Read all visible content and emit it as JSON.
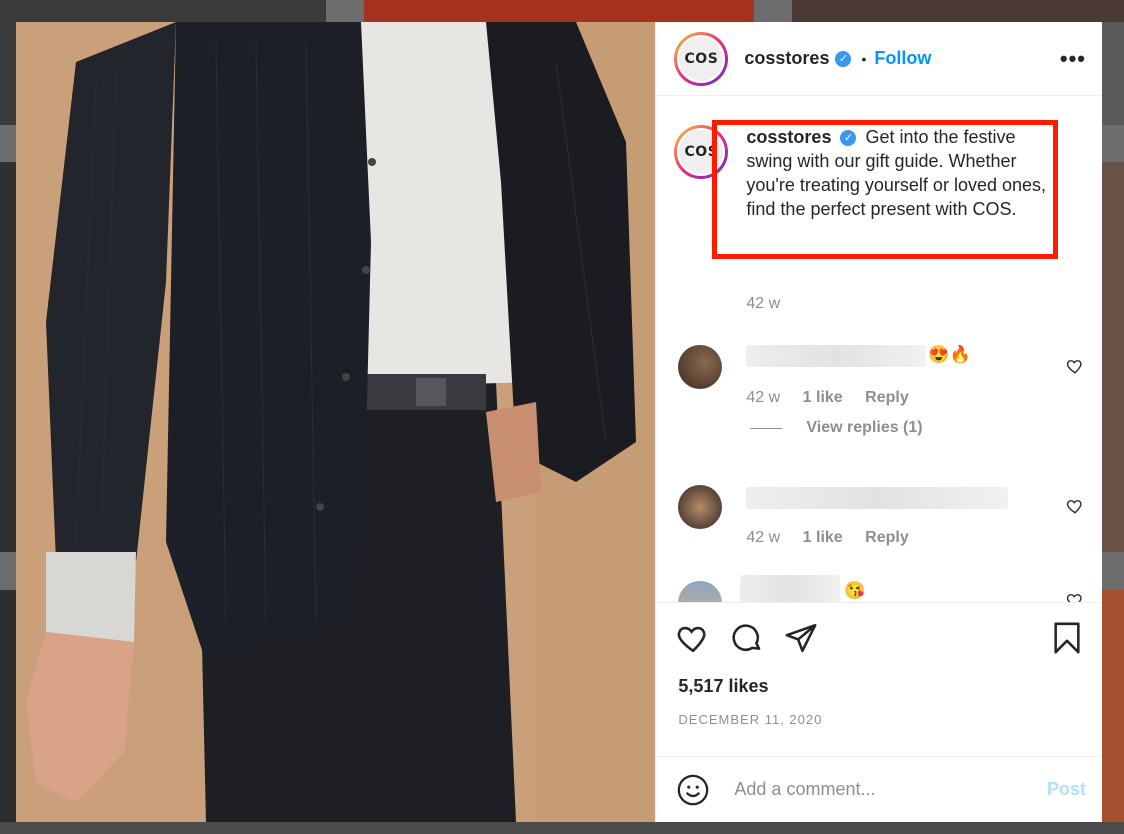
{
  "post": {
    "username": "cosstores",
    "avatar_text": "COS",
    "follow_label": "Follow",
    "separator": "•",
    "more_label": "•••",
    "verified_mark": "✓"
  },
  "caption": {
    "username": "cosstores",
    "text": "Get into the festive swing with our gift guide. Whether you're treating yourself or loved ones, find the perfect present with COS.",
    "age": "42 w"
  },
  "comments": [
    {
      "emoji": "😍🔥",
      "age": "42 w",
      "likes": "1 like",
      "reply": "Reply"
    },
    {
      "emoji": "",
      "age": "42 w",
      "likes": "1 like",
      "reply": "Reply"
    },
    {
      "emoji": "😘",
      "age": "",
      "likes": "",
      "reply": ""
    }
  ],
  "view_replies": "View replies (1)",
  "likes_count": "5,517 likes",
  "date": "DECEMBER 11, 2020",
  "add_comment": {
    "placeholder": "Add a comment...",
    "post_label": "Post"
  },
  "colors": {
    "accent": "#0095f6",
    "highlight": "#ff1a00",
    "muted": "#8e8e8e"
  }
}
